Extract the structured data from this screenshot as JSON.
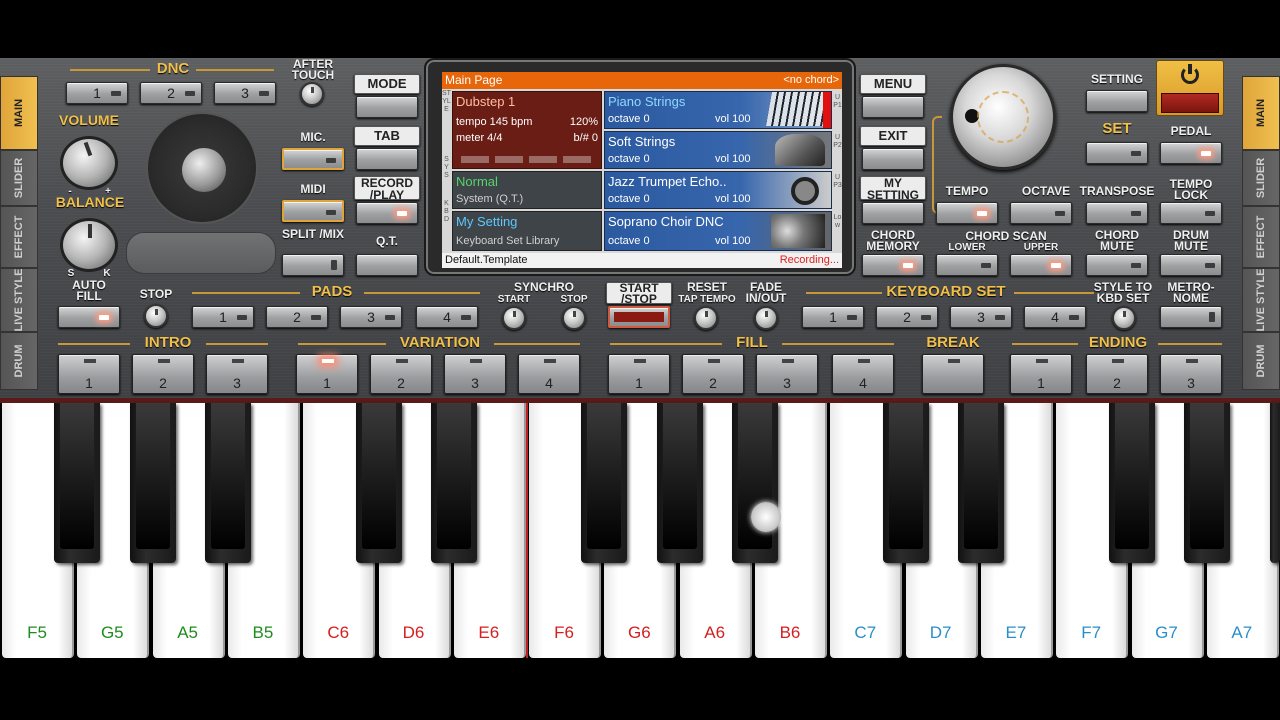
{
  "side_left": [
    "MAIN",
    "SLIDER",
    "EFFECT",
    "LIVE STYLE",
    "DRUM"
  ],
  "side_right": [
    "MAIN",
    "SLIDER",
    "EFFECT",
    "LIVE STYLE",
    "DRUM"
  ],
  "dnc": {
    "title": "DNC",
    "b1": "1",
    "b2": "2",
    "b3": "3",
    "after_touch": "AFTER TOUCH"
  },
  "volume": "VOLUME",
  "balance": "BALANCE",
  "balance_s": "S",
  "balance_k": "K",
  "vol_minus": "-",
  "vol_plus": "+",
  "mic": "MIC.",
  "midi": "MIDI",
  "split_mix": "SPLIT /MIX",
  "mode": "MODE",
  "tab": "TAB",
  "record_play": "RECORD /PLAY",
  "qt": "Q.T.",
  "menu": "MENU",
  "exit": "EXIT",
  "my_setting": "MY SETTING",
  "chord_memory": "CHORD MEMORY",
  "lcd": {
    "header_left": "Main Page",
    "header_right": "<no chord>",
    "style_side": "STYLE",
    "sys_side": "SYS",
    "kbd_side": "KBD",
    "style_name": "Dubstep 1",
    "tempo": "tempo 145 bpm",
    "tempo_pct": "120%",
    "meter": "meter 4/4",
    "bsharp": "b/# 0",
    "normal": "Normal",
    "system": "System (Q.T.)",
    "my_setting": "My Setting",
    "library": "Keyboard Set Library",
    "parts": [
      {
        "name": "Piano Strings",
        "octave": "octave 0",
        "vol": "vol 100",
        "side": "UP1"
      },
      {
        "name": "Soft Strings",
        "octave": "octave 0",
        "vol": "vol 100",
        "side": "UP2"
      },
      {
        "name": "Jazz Trumpet Echo..",
        "octave": "octave 0",
        "vol": "vol 100",
        "side": "UP3"
      },
      {
        "name": "Soprano Choir DNC",
        "octave": "octave 0",
        "vol": "vol 100",
        "side": "Low"
      }
    ],
    "footer_left": "Default.Template",
    "footer_right": "Recording..."
  },
  "right": {
    "setting": "SETTING",
    "set": "SET",
    "pedal": "PEDAL",
    "tempo": "TEMPO",
    "octave": "OCTAVE",
    "transpose": "TRANSPOSE",
    "tempo_lock": "TEMPO LOCK",
    "chord_scan": "CHORD SCAN",
    "lower": "LOWER",
    "upper": "UPPER",
    "chord_mute": "CHORD MUTE",
    "drum_mute": "DRUM MUTE"
  },
  "row3": {
    "auto_fill": "AUTO FILL",
    "stop": "STOP",
    "pads": "PADS",
    "p1": "1",
    "p2": "2",
    "p3": "3",
    "p4": "4",
    "synchro": "SYNCHRO",
    "sync_start": "START",
    "sync_stop": "STOP",
    "start_stop": "START /STOP",
    "reset": "RESET",
    "tap_tempo": "TAP TEMPO",
    "fade": "FADE IN/OUT",
    "keyboard_set": "KEYBOARD SET",
    "k1": "1",
    "k2": "2",
    "k3": "3",
    "k4": "4",
    "style_to_kbd": "STYLE TO KBD SET",
    "metronome": "METRO- NOME"
  },
  "row4": {
    "intro": "INTRO",
    "variation": "VARIATION",
    "fill": "FILL",
    "break": "BREAK",
    "ending": "ENDING",
    "intro_nums": [
      "1",
      "2",
      "3"
    ],
    "var_nums": [
      "1",
      "2",
      "3",
      "4"
    ],
    "fill_nums": [
      "1",
      "2",
      "3",
      "4"
    ],
    "ending_nums": [
      "1",
      "2",
      "3"
    ]
  },
  "keys": [
    {
      "note": "F5",
      "color": "#1f8c1f"
    },
    {
      "note": "G5",
      "color": "#1f8c1f"
    },
    {
      "note": "A5",
      "color": "#1f8c1f"
    },
    {
      "note": "B5",
      "color": "#1f8c1f"
    },
    {
      "note": "C6",
      "color": "#d42020"
    },
    {
      "note": "D6",
      "color": "#d42020"
    },
    {
      "note": "E6",
      "color": "#d42020"
    },
    {
      "note": "F6",
      "color": "#d42020"
    },
    {
      "note": "G6",
      "color": "#d42020"
    },
    {
      "note": "A6",
      "color": "#d42020"
    },
    {
      "note": "B6",
      "color": "#d42020"
    },
    {
      "note": "C7",
      "color": "#2a8fc8"
    },
    {
      "note": "D7",
      "color": "#2a8fc8"
    },
    {
      "note": "E7",
      "color": "#2a8fc8"
    },
    {
      "note": "F7",
      "color": "#2a8fc8"
    },
    {
      "note": "G7",
      "color": "#2a8fc8"
    },
    {
      "note": "A7",
      "color": "#2a8fc8"
    }
  ]
}
